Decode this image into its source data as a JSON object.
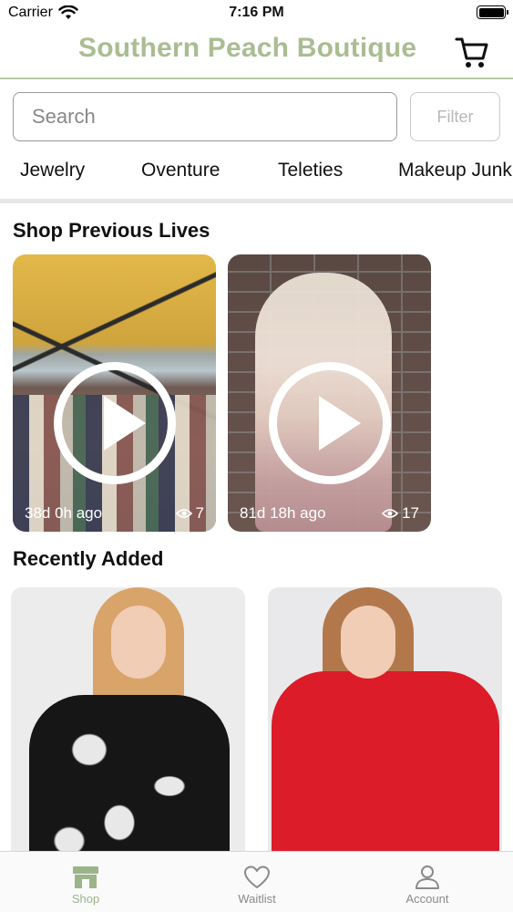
{
  "status": {
    "carrier": "Carrier",
    "time": "7:16 PM"
  },
  "header": {
    "title": "Southern Peach Boutique"
  },
  "search": {
    "placeholder": "Search",
    "filter_label": "Filter"
  },
  "categories": [
    "Jewelry",
    "Oventure",
    "Teleties",
    "Makeup Junk"
  ],
  "sections": {
    "lives_title": "Shop Previous Lives",
    "recent_title": "Recently Added"
  },
  "lives": [
    {
      "ago": "38d 0h ago",
      "views": "7"
    },
    {
      "ago": "81d 18h ago",
      "views": "17"
    }
  ],
  "tabs": [
    {
      "label": "Shop",
      "icon": "shop-icon",
      "active": true
    },
    {
      "label": "Waitlist",
      "icon": "heart-icon",
      "active": false
    },
    {
      "label": "Account",
      "icon": "person-icon",
      "active": false
    }
  ],
  "colors": {
    "accent": "#a9bd92",
    "header_rule": "#b7c9a4"
  }
}
